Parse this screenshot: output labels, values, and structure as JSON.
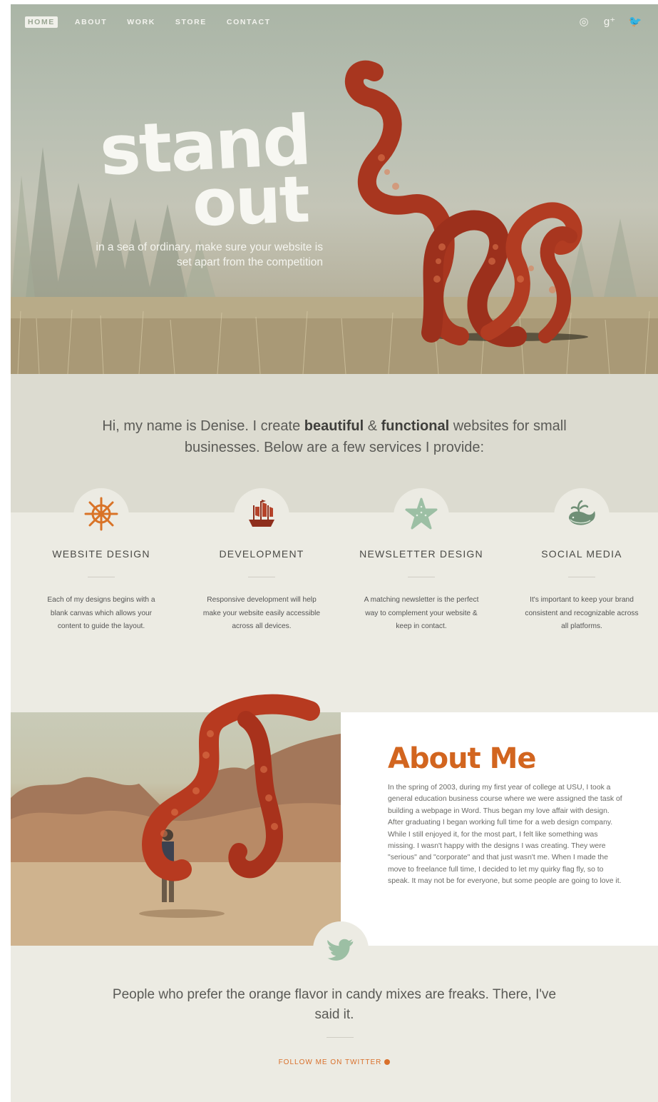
{
  "nav": {
    "items": [
      {
        "label": "HOME",
        "active": true
      },
      {
        "label": "ABOUT",
        "active": false
      },
      {
        "label": "WORK",
        "active": false
      },
      {
        "label": "STORE",
        "active": false
      },
      {
        "label": "CONTACT",
        "active": false
      }
    ],
    "social_icons": [
      "dribbble-icon",
      "google-plus-icon",
      "twitter-icon"
    ],
    "social_glyphs": [
      "◎",
      "g⁺",
      "🐦"
    ]
  },
  "hero": {
    "title_line1": "stand",
    "title_line2": "out",
    "subtitle": "in a sea of ordinary, make sure your website is set apart from the competition"
  },
  "intro": {
    "text_before": "Hi, my name is Denise. I create ",
    "bold1": "beautiful",
    "amp": " & ",
    "bold2": "functional",
    "text_after": " websites for small businesses. Below are a few services I provide:"
  },
  "services": [
    {
      "icon": "ship-wheel-icon",
      "title": "WEBSITE DESIGN",
      "description": "Each of my designs begins with a blank canvas which allows your content to guide the layout."
    },
    {
      "icon": "pirate-ship-icon",
      "title": "DEVELOPMENT",
      "description": "Responsive development will help make your website easily accessible across all devices."
    },
    {
      "icon": "starfish-icon",
      "title": "NEWSLETTER DESIGN",
      "description": "A matching newsletter is the perfect way to complement your website & keep in contact."
    },
    {
      "icon": "whale-icon",
      "title": "SOCIAL MEDIA",
      "description": "It's important to keep your brand consistent and recognizable across all platforms."
    }
  ],
  "about": {
    "title": "About Me",
    "body": "In the spring of 2003, during my first year of college at USU, I took a general education business course where we were assigned the task of building a webpage in Word. Thus began my love affair with design. After graduating I began working full time for a web design company. While I still enjoyed it, for the most part, I felt like something was missing. I wasn't happy with the designs I was creating. They were \"serious\" and \"corporate\" and that just wasn't me. When I made the move to freelance full time, I decided to let my quirky flag fly, so to speak. It may not be for everyone, but some people are going to love it."
  },
  "tweet": {
    "icon": "twitter-bird-icon",
    "text": "People who prefer the orange flavor in candy mixes are freaks. There, I've said it.",
    "follow_label": "FOLLOW ME ON TWITTER"
  },
  "colors": {
    "accent_orange": "#d2651f",
    "tentacle_red": "#a8361f",
    "mint": "#9cbfa4",
    "background": "#ecebe3"
  }
}
